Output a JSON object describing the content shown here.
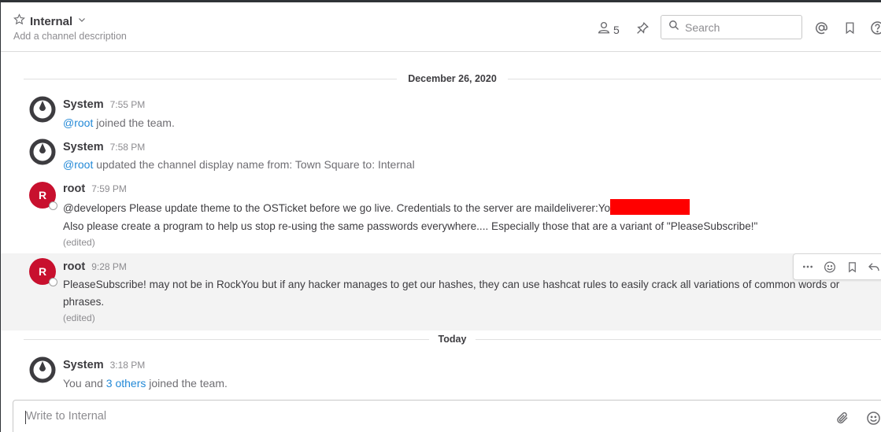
{
  "channel": {
    "name": "Internal",
    "description_placeholder": "Add a channel description",
    "member_count": "5"
  },
  "search": {
    "placeholder": "Search"
  },
  "separators": {
    "first_date": "December 26, 2020",
    "today": "Today"
  },
  "posts": [
    {
      "user": "System",
      "time": "7:55 PM",
      "mention": "@root",
      "text": " joined the team."
    },
    {
      "user": "System",
      "time": "7:58 PM",
      "mention": "@root",
      "text": " updated the channel display name from: Town Square to: Internal"
    },
    {
      "user": "root",
      "avatar_letter": "R",
      "time": "7:59 PM",
      "line1": "@developers Please update theme to the OSTicket before we go live.  Credentials to the server are maildeliverer:Yo",
      "line2": "Also please create a program to help us stop re-using the same passwords everywhere.... Especially those that are a variant of \"PleaseSubscribe!\"",
      "edited": "(edited)"
    },
    {
      "user": "root",
      "avatar_letter": "R",
      "time": "9:28 PM",
      "line1": "PleaseSubscribe! may not be in RockYou but if any hacker manages to get our hashes, they can use hashcat rules to easily crack all variations of common words or",
      "line2": "phrases.",
      "edited": "(edited)"
    },
    {
      "user": "System",
      "time": "3:18 PM",
      "prefix": "You and ",
      "link": "3 others",
      "suffix": " joined the team."
    }
  ],
  "composer": {
    "placeholder": "Write to Internal"
  },
  "colors": {
    "accent": "#2389d7",
    "avatar_red": "#c8102e",
    "redaction": "#ff0000"
  }
}
